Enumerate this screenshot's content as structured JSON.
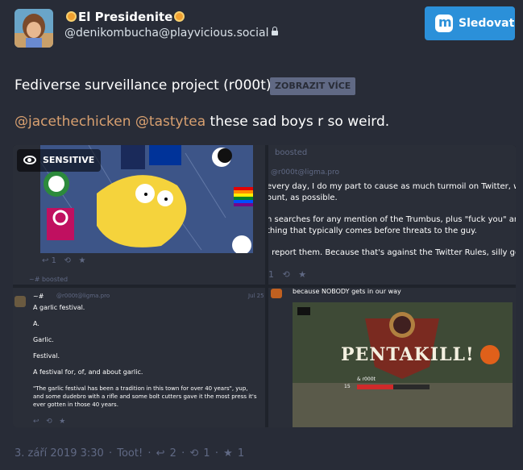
{
  "header": {
    "display_name": "El Presidenite",
    "account": "@denikombucha@playvicious.social",
    "follow_label": "Sledovat"
  },
  "status": {
    "spoiler_text": "Fediverse surveillance project (r000t)",
    "show_more_label": "ZOBRAZIT VÍCE",
    "mentions": [
      "@jacethechicken",
      "@tastytea"
    ],
    "text": "these sad boys r so weird."
  },
  "media": {
    "sensitive_label": "SENSITIVE",
    "tile2": {
      "boosted": "boosted",
      "handle": "@r000t@ligma.pro",
      "lines": [
        "every day, I do my part to cause as much turmoil on Twitter, with a s",
        "ount, as possible.",
        "n searches for any mention of the Trumbus, plus \"fuck you\" and \"I ho",
        "thing that typically comes before threats to the guy.",
        "I report them. Because that's against the Twitter Rules, silly goose!"
      ],
      "count": "1"
    },
    "tile1": {
      "counts": "1",
      "boost": "~# boosted"
    },
    "tile3": {
      "name": "~#",
      "handle": "@r000t@ligma.pro",
      "date": "Jul 25",
      "lines": [
        "A garlic festival.",
        "A.",
        "Garlic.",
        "Festival.",
        "A festival for, of, and about garlic.",
        "\"The garlic festival has been a tradition in this town for over 40 years\", yup, and some dudebro with a rifle and some bolt cutters gave it the most press it's ever gotten in those 40 years."
      ]
    },
    "tile4": {
      "caption": "because NOBODY gets in our way",
      "banner": "PENTAKILL!",
      "player": "& r000t",
      "level": "15"
    }
  },
  "footer": {
    "date": "3. září 2019 3:30",
    "separator": "·",
    "app": "Toot!",
    "replies": "2",
    "boosts": "1",
    "favs": "1"
  }
}
